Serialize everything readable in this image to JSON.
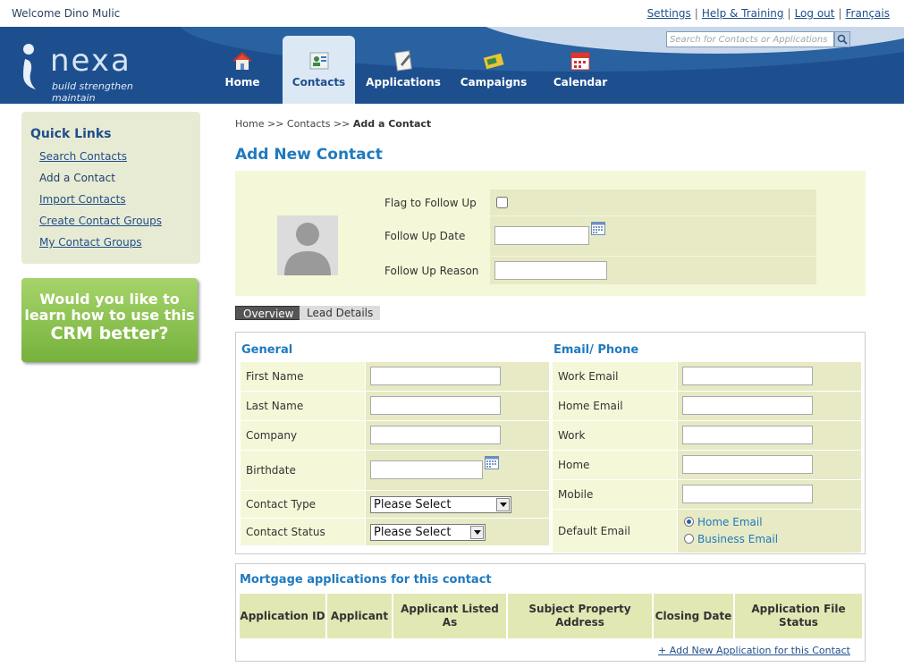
{
  "topbar": {
    "welcome": "Welcome Dino Mulic",
    "links": [
      "Settings",
      "Help & Training",
      "Log out",
      "Français"
    ]
  },
  "header": {
    "logo_word": "nexa",
    "logo_tagline": "build strengthen maintain",
    "search_placeholder": "Search for Contacts or Applications"
  },
  "nav": {
    "items": [
      {
        "label": "Home",
        "icon": "house-icon"
      },
      {
        "label": "Contacts",
        "icon": "contacts-icon",
        "active": true
      },
      {
        "label": "Applications",
        "icon": "applications-icon"
      },
      {
        "label": "Campaigns",
        "icon": "campaigns-icon"
      },
      {
        "label": "Calendar",
        "icon": "calendar-icon"
      }
    ]
  },
  "quick_links": {
    "title": "Quick Links",
    "items": [
      "Search Contacts",
      "Add a Contact",
      "Import Contacts",
      "Create Contact Groups",
      "My Contact Groups"
    ],
    "current": "Add a Contact"
  },
  "promo": {
    "line1": "Would you like to",
    "line2": "learn how to use this",
    "line3": "CRM better?"
  },
  "breadcrumb": {
    "home": "Home",
    "sep": ">>",
    "contacts": "Contacts",
    "current": "Add a Contact"
  },
  "page_title": "Add New Contact",
  "follow_up": {
    "flag_label": "Flag to Follow Up",
    "date_label": "Follow Up Date",
    "reason_label": "Follow Up Reason",
    "flag_checked": false,
    "date_value": "",
    "reason_value": ""
  },
  "tabs": [
    "Overview",
    "Lead Details"
  ],
  "general": {
    "title": "General",
    "first_name": "First Name",
    "last_name": "Last Name",
    "company": "Company",
    "birthdate": "Birthdate",
    "contact_type": "Contact Type",
    "contact_status": "Contact Status",
    "select_default": "Please Select"
  },
  "email_phone": {
    "title": "Email/ Phone",
    "work_email": "Work Email",
    "home_email": "Home Email",
    "work": "Work",
    "home": "Home",
    "mobile": "Mobile",
    "default_email": "Default Email",
    "radio_home": "Home Email",
    "radio_business": "Business Email",
    "selected": "Home Email"
  },
  "mortgage": {
    "title": "Mortgage applications for this contact",
    "columns": [
      "Application ID",
      "Applicant",
      "Applicant Listed As",
      "Subject Property Address",
      "Closing Date",
      "Application File Status"
    ],
    "add_link": "+ Add New Application for this Contact"
  },
  "colors": {
    "header_blue": "#1d4f8f",
    "title_blue": "#1f7abf",
    "panel_green": "#f4f8d8",
    "cell_green": "#e7eac4"
  }
}
